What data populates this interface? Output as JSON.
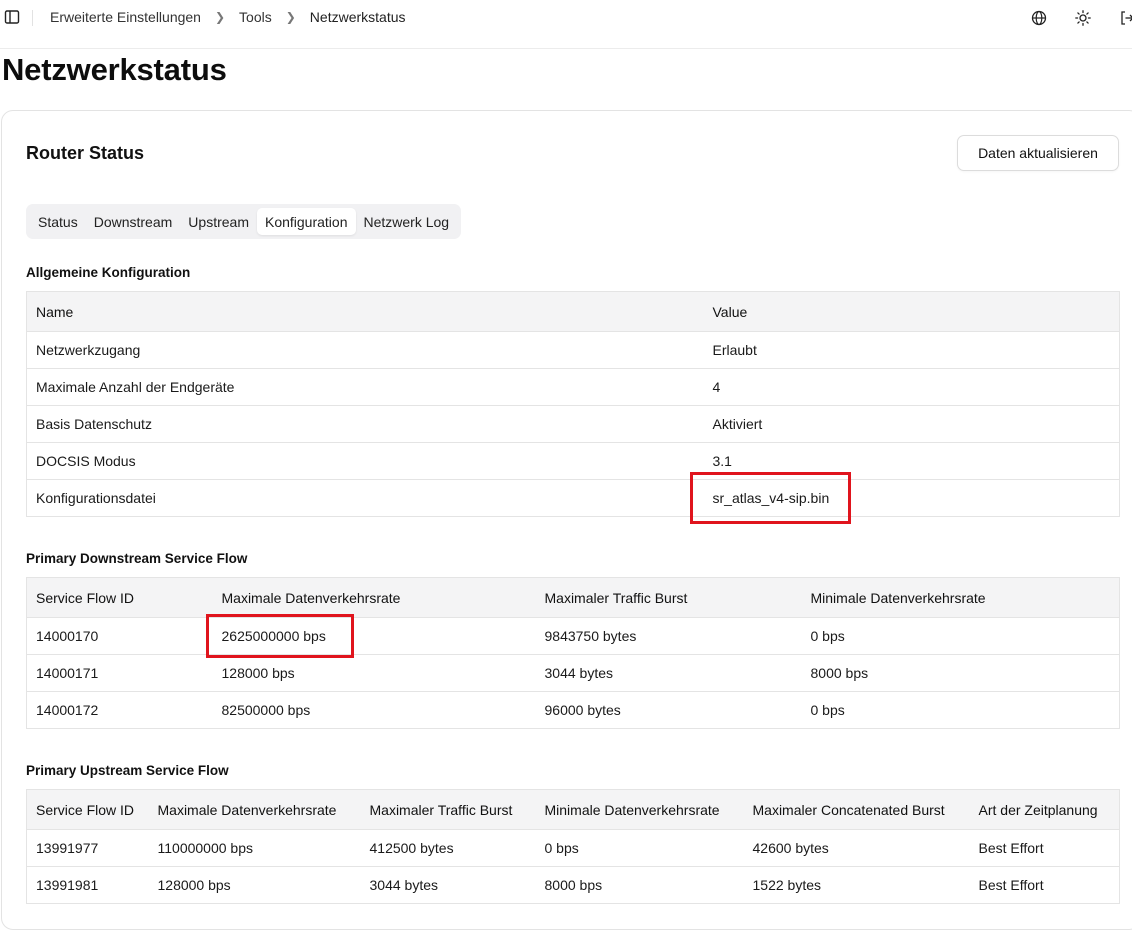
{
  "breadcrumb": {
    "items": [
      "Erweiterte Einstellungen",
      "Tools",
      "Netzwerkstatus"
    ]
  },
  "icons": {
    "sidebar_toggle": "sidebar-toggle-icon",
    "language": "globe-icon",
    "theme": "sun-icon",
    "logout": "logout-icon"
  },
  "page": {
    "title": "Netzwerkstatus"
  },
  "card": {
    "title": "Router Status",
    "refresh_label": "Daten aktualisieren"
  },
  "tabs": [
    {
      "label": "Status"
    },
    {
      "label": "Downstream"
    },
    {
      "label": "Upstream"
    },
    {
      "label": "Konfiguration",
      "active": true
    },
    {
      "label": "Netzwerk Log"
    }
  ],
  "general_config": {
    "title": "Allgemeine Konfiguration",
    "headers": [
      "Name",
      "Value"
    ],
    "rows": [
      [
        "Netzwerkzugang",
        "Erlaubt"
      ],
      [
        "Maximale Anzahl der Endgeräte",
        "4"
      ],
      [
        "Basis Datenschutz",
        "Aktiviert"
      ],
      [
        "DOCSIS Modus",
        "3.1"
      ],
      [
        "Konfigurationsdatei",
        "sr_atlas_v4-sip.bin"
      ]
    ]
  },
  "downstream_flow": {
    "title": "Primary Downstream Service Flow",
    "headers": [
      "Service Flow ID",
      "Maximale Datenverkehrsrate",
      "Maximaler Traffic Burst",
      "Minimale Datenverkehrsrate"
    ],
    "rows": [
      [
        "14000170",
        "2625000000 bps",
        "9843750 bytes",
        "0 bps"
      ],
      [
        "14000171",
        "128000 bps",
        "3044 bytes",
        "8000 bps"
      ],
      [
        "14000172",
        "82500000 bps",
        "96000 bytes",
        "0 bps"
      ]
    ]
  },
  "upstream_flow": {
    "title": "Primary Upstream Service Flow",
    "headers": [
      "Service Flow ID",
      "Maximale Datenverkehrsrate",
      "Maximaler Traffic Burst",
      "Minimale Datenverkehrsrate",
      "Maximaler Concatenated Burst",
      "Art der Zeitplanung"
    ],
    "rows": [
      [
        "13991977",
        "110000000 bps",
        "412500 bytes",
        "0 bps",
        "42600 bytes",
        "Best Effort"
      ],
      [
        "13991981",
        "128000 bps",
        "3044 bytes",
        "8000 bps",
        "1522 bytes",
        "Best Effort"
      ]
    ]
  },
  "colors": {
    "highlight": "#e0141d",
    "header_bg": "#f4f4f5",
    "tabs_bg": "#f1f1f3"
  }
}
